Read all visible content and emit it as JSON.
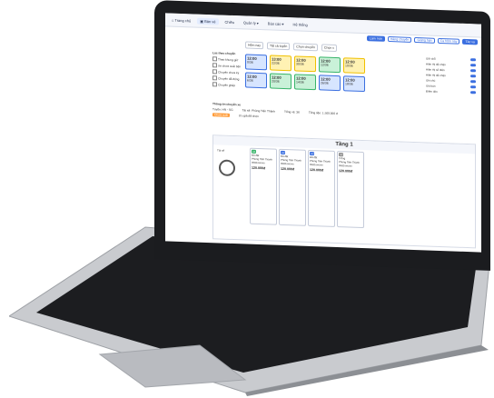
{
  "nav": {
    "tabs": [
      "Trang chủ",
      "Bán vé",
      "Chiều",
      "Quản lý",
      "Báo cáo",
      "Hệ thống"
    ]
  },
  "toolbar": {
    "buttons": [
      "Làm mới",
      "Hàng chuyến",
      "Giảng hạn",
      "Ca hôm nay",
      "Tác vụ"
    ]
  },
  "filters": {
    "date": "Hôm nay",
    "route": "Tất cả tuyến",
    "group": "Chọn chuyến",
    "seats": "Chọn v"
  },
  "sidebar": {
    "heading": "Lọc theo chuyến",
    "options": [
      "Theo khung giờ",
      "Xe chưa xuất bến",
      "Chuyến chưa ký",
      "Chuyến đã đóng",
      "Chuyến ghép"
    ]
  },
  "slots": [
    {
      "time": "12:00",
      "sub": "0/36",
      "color": "blue"
    },
    {
      "time": "13:00",
      "sub": "22/36",
      "color": "yellow"
    },
    {
      "time": "12:00",
      "sub": "30/36",
      "color": "yellow"
    },
    {
      "time": "12:00",
      "sub": "12/36",
      "color": "green"
    },
    {
      "time": "12:00",
      "sub": "10/36",
      "color": "yellow"
    },
    {
      "time": "12:00",
      "sub": "6/36",
      "color": "blue"
    },
    {
      "time": "12:00",
      "sub": "20/36",
      "color": "green"
    },
    {
      "time": "12:00",
      "sub": "14/36",
      "color": "green"
    },
    {
      "time": "12:00",
      "sub": "26/36",
      "color": "blue"
    },
    {
      "time": "12:00",
      "sub": "18/36",
      "color": "blue"
    }
  ],
  "right_settings": [
    "Giữ chỗ",
    "Hiện thị đã nhận",
    "Hiện thị số điện",
    "Hiện thị đã nhận",
    "Ghi chú",
    "Giá bán",
    "Điểm đón"
  ],
  "info": {
    "label_trip": "Thông tin chuyến xe",
    "route": "Tuyến: HN - SG",
    "driver": "Tài xế: Phùng Tiến Thành",
    "seats_total": "Tổng vé: 36",
    "revenue": "Tổng tiền: 1.500.000 đ",
    "tag": "Chưa xuất",
    "legend_label": "Ưu giá đã chọn"
  },
  "floor": {
    "title": "Tầng 1",
    "driver_label": "Tài xế"
  },
  "seats": [
    {
      "code": "A1",
      "status": "Đã đặt",
      "name": "Phùng Tiến Thành",
      "phone": "0982xxxxxx",
      "price": "120.000đ",
      "tag": "green"
    },
    {
      "code": "A2",
      "status": "Đã đặt",
      "name": "Phùng Tiến Thành",
      "phone": "0982xxxxxx",
      "price": "120.000đ",
      "tag": "blue"
    },
    {
      "code": "A3",
      "status": "Đã đặt",
      "name": "Phùng Tiến Thành",
      "phone": "0982xxxxxx",
      "price": "120.000đ",
      "tag": "blue"
    },
    {
      "code": "A4",
      "status": "Trống",
      "name": "Phùng Tiến Thành",
      "phone": "0982xxxxxx",
      "price": "120.000đ",
      "tag": "gray"
    }
  ]
}
